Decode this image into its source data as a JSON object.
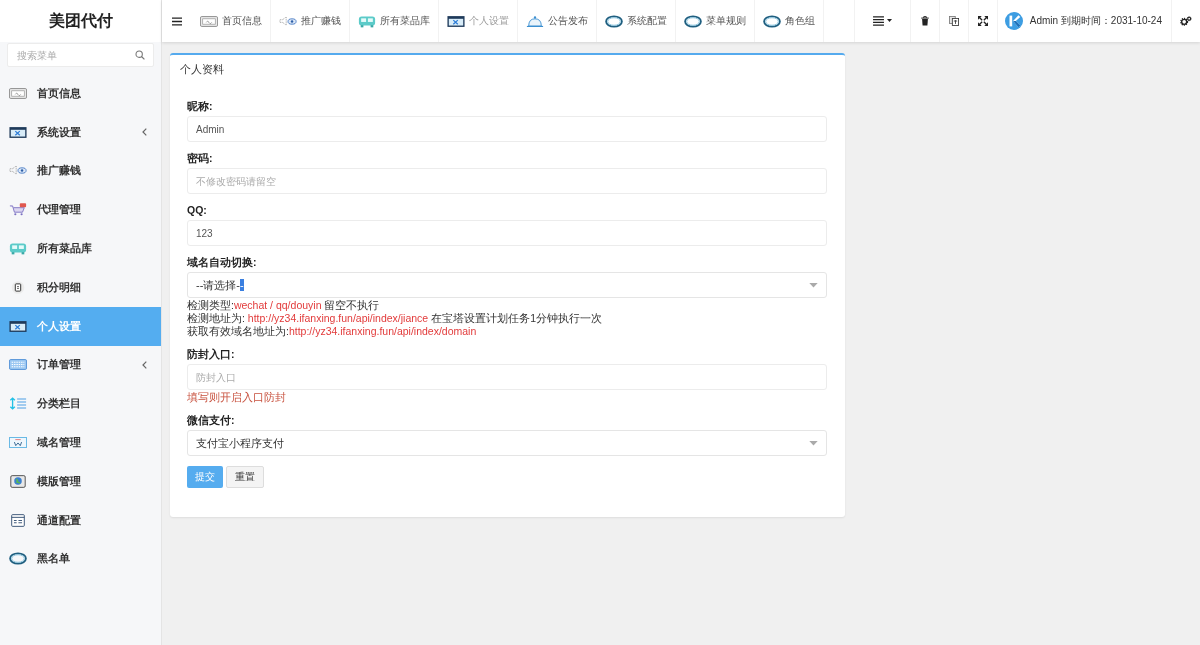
{
  "sidebar": {
    "title": "美团代付",
    "search": {
      "placeholder": "搜索菜单"
    },
    "items": [
      {
        "label": "首页信息",
        "selected": false,
        "has_submenu": false
      },
      {
        "label": "系统设置",
        "selected": false,
        "has_submenu": true
      },
      {
        "label": "推广赚钱",
        "selected": false,
        "has_submenu": false
      },
      {
        "label": "代理管理",
        "selected": false,
        "has_submenu": false
      },
      {
        "label": "所有菜品库",
        "selected": false,
        "has_submenu": false
      },
      {
        "label": "积分明细",
        "selected": false,
        "has_submenu": false
      },
      {
        "label": "个人设置",
        "selected": true,
        "has_submenu": false
      },
      {
        "label": "订单管理",
        "selected": false,
        "has_submenu": true
      },
      {
        "label": "分类栏目",
        "selected": false,
        "has_submenu": false
      },
      {
        "label": "域名管理",
        "selected": false,
        "has_submenu": false
      },
      {
        "label": "模版管理",
        "selected": false,
        "has_submenu": false
      },
      {
        "label": "通道配置",
        "selected": false,
        "has_submenu": false
      },
      {
        "label": "黑名单",
        "selected": false,
        "has_submenu": false
      }
    ]
  },
  "topbar": {
    "tabs": [
      {
        "label": "首页信息",
        "selected": false
      },
      {
        "label": "推广赚钱",
        "selected": false
      },
      {
        "label": "所有菜品库",
        "selected": false
      },
      {
        "label": "个人设置",
        "selected": true
      },
      {
        "label": "公告发布",
        "selected": false
      },
      {
        "label": "系统配置",
        "selected": false
      },
      {
        "label": "菜单规则",
        "selected": false
      },
      {
        "label": "角色组",
        "selected": false
      }
    ],
    "user": "Admin 到期时间：2031-10-24"
  },
  "panel": {
    "title": "个人资料",
    "fields": [
      {
        "kind": "input",
        "label": "昵称:",
        "value": "Admin"
      },
      {
        "kind": "input",
        "label": "密码:",
        "placeholder": "不修改密码请留空"
      },
      {
        "kind": "input",
        "label": "QQ:",
        "value": "123"
      },
      {
        "kind": "select",
        "label": "域名自动切换:",
        "value": "--请选择-",
        "selected_text": "-",
        "help": [
          [
            {
              "text": "检测类型:",
              "highlight": false
            },
            {
              "text": "wechat / qq/douyin",
              "highlight": true
            },
            {
              "text": " 留空不执行",
              "highlight": false
            }
          ],
          [
            {
              "text": "检测地址为: ",
              "highlight": false
            },
            {
              "text": "http://yz34.ifanxing.fun/api/index/jiance",
              "highlight": true
            },
            {
              "text": " 在宝塔设置计划任务1分钟执行一次",
              "highlight": false
            }
          ],
          [
            {
              "text": "获取有效域名地址为:",
              "highlight": false
            },
            {
              "text": "http://yz34.ifanxing.fun/api/index/domain",
              "highlight": true
            }
          ]
        ]
      },
      {
        "kind": "input",
        "label": "防封入口:",
        "placeholder": "防封入口",
        "note": "填写则开启入口防封"
      },
      {
        "kind": "select",
        "label": "微信支付:",
        "value": "支付宝小程序支付"
      }
    ],
    "buttons": [
      {
        "label": "提交",
        "kind": "primary"
      },
      {
        "label": "重置",
        "kind": "default"
      }
    ]
  }
}
